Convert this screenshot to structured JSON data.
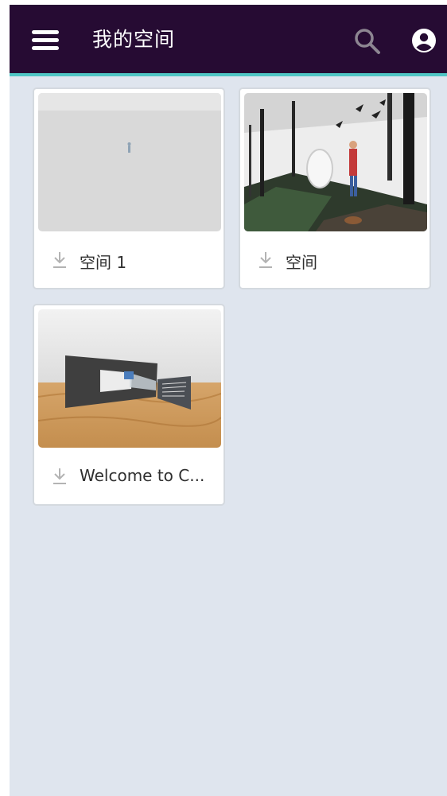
{
  "header": {
    "title": "我的空间",
    "colors": {
      "bar": "#260b33",
      "accent_line": "#4fc6c4"
    },
    "icons": [
      "menu-icon",
      "search-icon",
      "account-icon"
    ]
  },
  "rooms": [
    {
      "name": "空间 1",
      "icon": "download-icon"
    },
    {
      "name": "空间",
      "icon": "download-icon"
    },
    {
      "name": "Welcome to C...",
      "icon": "download-icon"
    }
  ]
}
